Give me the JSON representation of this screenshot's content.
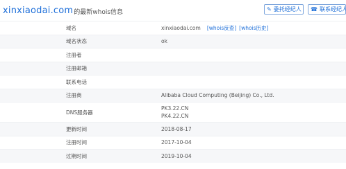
{
  "header": {
    "domain": "xinxiaodai.com",
    "suffix": "的最新whois信息",
    "entrust_button": "委托经纪人",
    "contact_button": "联系经纪人"
  },
  "rows": [
    {
      "label": "域名",
      "value": "xinxiaodai.com",
      "links": [
        "[whois反查]",
        "[whois历史]"
      ]
    },
    {
      "label": "域名状态",
      "value": "ok"
    },
    {
      "label": "注册者",
      "value": ""
    },
    {
      "label": "注册邮箱",
      "value": ""
    },
    {
      "label": "联系电话",
      "value": ""
    },
    {
      "label": "注册商",
      "value": "Alibaba Cloud Computing (Beijing) Co., Ltd."
    },
    {
      "label": "DNS服务器",
      "values": [
        "PK3.22.CN",
        "PK4.22.CN"
      ]
    },
    {
      "label": "更新时间",
      "value": "2018-08-17"
    },
    {
      "label": "注册时间",
      "value": "2017-10-04"
    },
    {
      "label": "过期时间",
      "value": "2019-10-04"
    }
  ]
}
